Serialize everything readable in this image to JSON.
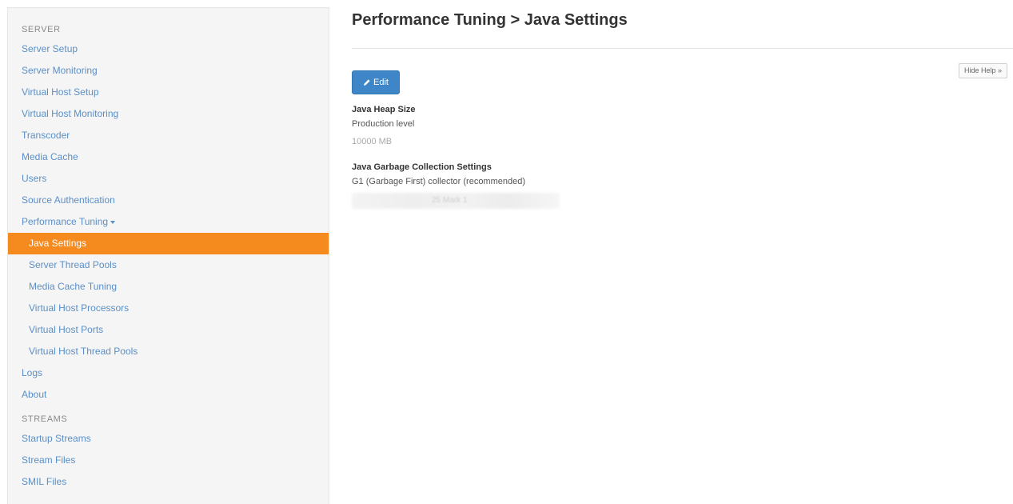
{
  "sidebar": {
    "server_header": "SERVER",
    "server_items": [
      {
        "label": "Server Setup"
      },
      {
        "label": "Server Monitoring"
      },
      {
        "label": "Virtual Host Setup"
      },
      {
        "label": "Virtual Host Monitoring"
      },
      {
        "label": "Transcoder"
      },
      {
        "label": "Media Cache"
      },
      {
        "label": "Users"
      },
      {
        "label": "Source Authentication"
      },
      {
        "label": "Performance Tuning"
      }
    ],
    "performance_subitems": [
      {
        "label": "Java Settings",
        "active": true
      },
      {
        "label": "Server Thread Pools"
      },
      {
        "label": "Media Cache Tuning"
      },
      {
        "label": "Virtual Host Processors"
      },
      {
        "label": "Virtual Host Ports"
      },
      {
        "label": "Virtual Host Thread Pools"
      }
    ],
    "after_items": [
      {
        "label": "Logs"
      },
      {
        "label": "About"
      }
    ],
    "streams_header": "STREAMS",
    "streams_items": [
      {
        "label": "Startup Streams"
      },
      {
        "label": "Stream Files"
      },
      {
        "label": "SMIL Files"
      }
    ]
  },
  "main": {
    "title": "Performance Tuning > Java Settings",
    "edit_label": "Edit",
    "hide_help_label": "Hide Help »",
    "heap": {
      "label": "Java Heap Size",
      "desc": "Production level",
      "value": "10000 MB"
    },
    "gc": {
      "label": "Java Garbage Collection Settings",
      "desc": "G1 (Garbage First) collector (recommended)",
      "blurred_value": "25 Mark 1"
    }
  },
  "colors": {
    "accent_active": "#f58a1f",
    "link": "#5b8fc7",
    "button": "#3e86c7"
  }
}
